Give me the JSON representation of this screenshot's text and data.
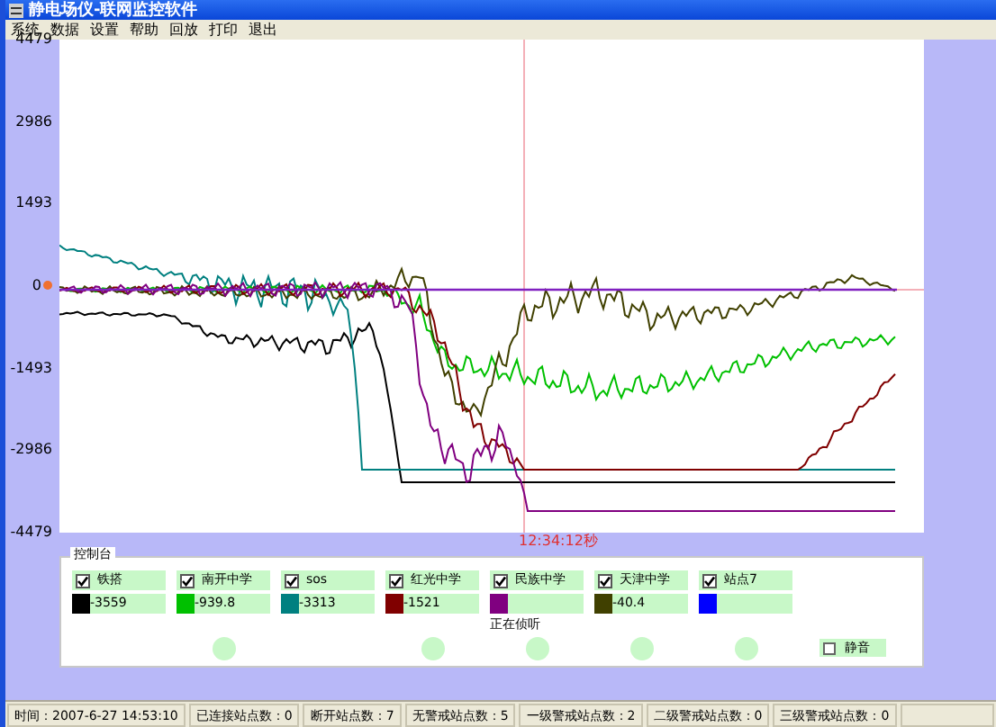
{
  "window": {
    "title": "静电场仪-联网监控软件"
  },
  "menu": [
    "系统",
    "数据",
    "设置",
    "帮助",
    "回放",
    "打印",
    "退出"
  ],
  "chart": {
    "y_labels": [
      "4479",
      "2986",
      "1493",
      "0",
      "-1493",
      "-2986",
      "-4479"
    ],
    "cursor_time": "12:34:12秒"
  },
  "control_panel": {
    "title": "控制台",
    "stations": [
      {
        "name": "铁搭",
        "checked": true,
        "color": "#000000",
        "reading": "-3559",
        "light": false
      },
      {
        "name": "南开中学",
        "checked": true,
        "color": "#00c000",
        "reading": "-939.8",
        "light": true
      },
      {
        "name": "sos",
        "checked": true,
        "color": "#008080",
        "reading": "-3313",
        "light": false
      },
      {
        "name": "红光中学",
        "checked": true,
        "color": "#800000",
        "reading": "-1521",
        "light": true
      },
      {
        "name": "民族中学",
        "checked": true,
        "color": "#800080",
        "light": true
      },
      {
        "name": "天津中学",
        "checked": true,
        "color": "#404000",
        "reading": "-40.4",
        "light": true
      },
      {
        "name": "站点7",
        "checked": true,
        "color": "#0000ff",
        "light": true
      }
    ],
    "status_text": "正在侦听",
    "mute": {
      "label": "静音",
      "checked": false
    }
  },
  "status_bar": [
    "时间：2007-6-27 14:53:10",
    "已连接站点数：0",
    "断开站点数：7",
    "无警戒站点数：5",
    "一级警戒站点数：2",
    "二级警戒站点数：0",
    "三级警戒站点数：0"
  ]
}
